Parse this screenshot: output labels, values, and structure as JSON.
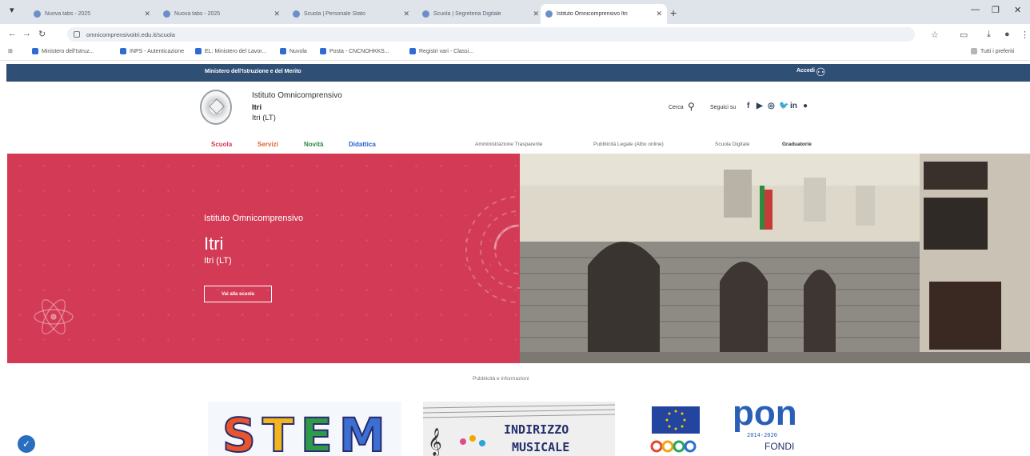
{
  "browser": {
    "tabs": [
      {
        "title": "Nuova tabs - 2025",
        "active": false
      },
      {
        "title": "Nuova tabs - 2025",
        "active": false
      },
      {
        "title": "Scuola | Personale Stato",
        "active": false
      },
      {
        "title": "Scuola | Segreteria Digitale",
        "active": false
      },
      {
        "title": "Istituto Omnicomprensivo Itri",
        "active": true
      }
    ],
    "url": "omnicomprensivoitri.edu.it/scuola",
    "bookmarks": [
      "Ministero dell'Istruz...",
      "INPS - Autenticazione",
      "EL: Ministero del Lavor...",
      "Nuvola",
      "Posta - CNCNOHKKS...",
      "Registri vari - Classi..."
    ],
    "all_bookmarks": "Tutti i preferiti"
  },
  "site": {
    "ministry_label": "Ministero dell'Istruzione e del Merito",
    "access_label": "Accedi",
    "institute_line1": "Istituto Omnicomprensivo",
    "institute_name": "Itri",
    "institute_place": "Itri (LT)",
    "search_label": "Cerca",
    "follow_label": "Seguici su",
    "social": [
      "f",
      "▶",
      "◎",
      "🐦",
      "in",
      "●"
    ],
    "main_nav": [
      {
        "label": "Scuola",
        "color": "#d33a55"
      },
      {
        "label": "Servizi",
        "color": "#e0622f"
      },
      {
        "label": "Novità",
        "color": "#2e8a3e"
      },
      {
        "label": "Didattica",
        "color": "#2a5fd0"
      }
    ],
    "secondary_nav": [
      "Amministrazione Trasparente",
      "Pubblicità Legale (Albo online)",
      "Scuola Digitale",
      "Graduatorie"
    ]
  },
  "hero": {
    "line1": "Istituto Omnicomprensivo",
    "title": "Itri",
    "place": "Itri (LT)",
    "button": "Vai alla scuola"
  },
  "section": {
    "title": "Pubblicità e informazioni"
  },
  "cards": [
    {
      "label": "STEM"
    },
    {
      "label_top": "INDIRIZZO",
      "label_bottom": "MUSICALE"
    },
    {
      "label": "pon",
      "years": "2014-2020",
      "fondi": "FONDI"
    }
  ],
  "colors": {
    "topbar": "#2f4f75",
    "hero": "#d33a55"
  }
}
